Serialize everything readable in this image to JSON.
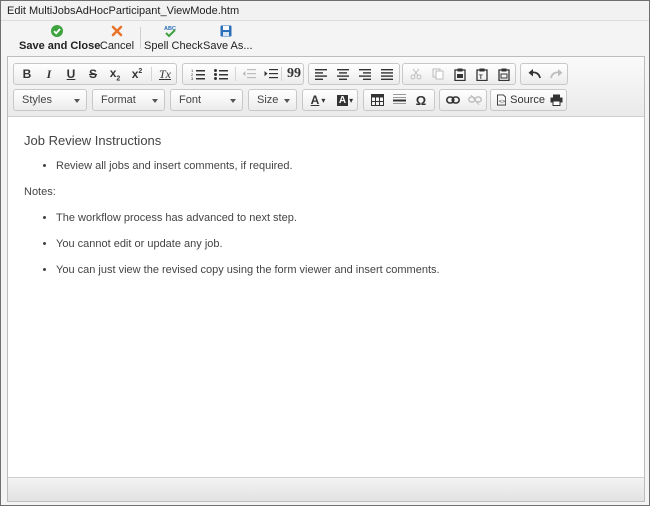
{
  "window": {
    "title": "Edit MultiJobsAdHocParticipant_ViewMode.htm"
  },
  "actions": {
    "save_close": "Save and Close",
    "cancel": "Cancel",
    "spell_check": "Spell Check",
    "save_as": "Save As...",
    "icons": {
      "save_close": "check-circle-icon",
      "cancel": "x-icon",
      "spell_check": "spell-check-icon",
      "save_as": "floppy-disk-icon"
    }
  },
  "toolbar": {
    "styles": "Styles",
    "format": "Format",
    "font": "Font",
    "size": "Size",
    "source": "Source",
    "bold": "B",
    "italic": "I",
    "underline": "U",
    "strike": "S",
    "subscript": "x",
    "superscript": "x",
    "sub_suffix": "2",
    "sup_suffix": "2",
    "clear_format": "Tx",
    "blockquote": "99",
    "font_color": "A",
    "bg_color": "A",
    "omega": "Ω"
  },
  "document": {
    "heading": "Job Review Instructions",
    "bullets_1": [
      "Review all jobs and insert comments, if required."
    ],
    "notes_label": "Notes:",
    "bullets_2": [
      "The workflow process has advanced to next step.",
      "You cannot edit or update any job.",
      "You can just view the revised copy using the form viewer and insert comments."
    ]
  },
  "colors": {
    "check_green": "#3ea33e",
    "cancel_orange": "#e8742a",
    "save_blue": "#2a6fb8"
  }
}
